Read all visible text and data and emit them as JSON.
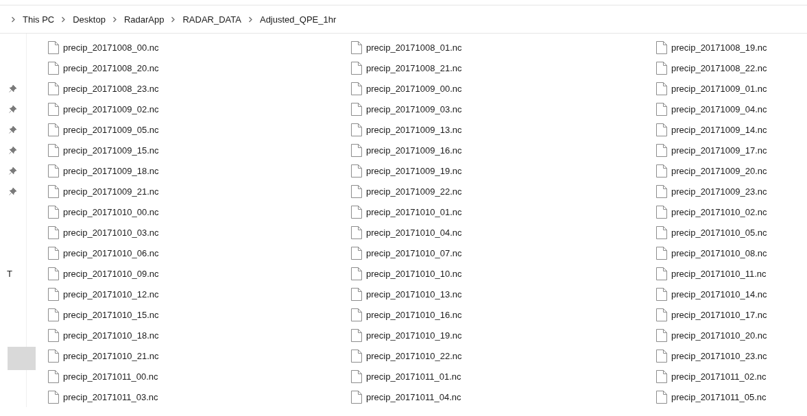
{
  "breadcrumb": [
    "This PC",
    "Desktop",
    "RadarApp",
    "RADAR_DATA",
    "Adjusted_QPE_1hr"
  ],
  "sidebar": {
    "items": [
      {
        "pinned": false,
        "selected": false
      },
      {
        "pinned": false,
        "selected": false
      },
      {
        "pinned": true,
        "selected": false
      },
      {
        "pinned": true,
        "selected": false
      },
      {
        "pinned": true,
        "selected": false
      },
      {
        "pinned": true,
        "selected": false
      },
      {
        "pinned": true,
        "selected": false
      },
      {
        "pinned": true,
        "selected": false
      },
      {
        "pinned": false,
        "selected": false
      },
      {
        "pinned": false,
        "selected": false
      },
      {
        "pinned": false,
        "selected": false
      },
      {
        "label": "T",
        "pinned": false,
        "selected": false
      },
      {
        "pinned": false,
        "selected": false
      },
      {
        "pinned": false,
        "selected": false
      },
      {
        "pinned": false,
        "selected": false
      },
      {
        "pinned": false,
        "selected": true
      }
    ]
  },
  "files": [
    "precip_20171008_00.nc",
    "precip_20171008_01.nc",
    "precip_20171008_19.nc",
    "precip_20171008_20.nc",
    "precip_20171008_21.nc",
    "precip_20171008_22.nc",
    "precip_20171008_23.nc",
    "precip_20171009_00.nc",
    "precip_20171009_01.nc",
    "precip_20171009_02.nc",
    "precip_20171009_03.nc",
    "precip_20171009_04.nc",
    "precip_20171009_05.nc",
    "precip_20171009_13.nc",
    "precip_20171009_14.nc",
    "precip_20171009_15.nc",
    "precip_20171009_16.nc",
    "precip_20171009_17.nc",
    "precip_20171009_18.nc",
    "precip_20171009_19.nc",
    "precip_20171009_20.nc",
    "precip_20171009_21.nc",
    "precip_20171009_22.nc",
    "precip_20171009_23.nc",
    "precip_20171010_00.nc",
    "precip_20171010_01.nc",
    "precip_20171010_02.nc",
    "precip_20171010_03.nc",
    "precip_20171010_04.nc",
    "precip_20171010_05.nc",
    "precip_20171010_06.nc",
    "precip_20171010_07.nc",
    "precip_20171010_08.nc",
    "precip_20171010_09.nc",
    "precip_20171010_10.nc",
    "precip_20171010_11.nc",
    "precip_20171010_12.nc",
    "precip_20171010_13.nc",
    "precip_20171010_14.nc",
    "precip_20171010_15.nc",
    "precip_20171010_16.nc",
    "precip_20171010_17.nc",
    "precip_20171010_18.nc",
    "precip_20171010_19.nc",
    "precip_20171010_20.nc",
    "precip_20171010_21.nc",
    "precip_20171010_22.nc",
    "precip_20171010_23.nc",
    "precip_20171011_00.nc",
    "precip_20171011_01.nc",
    "precip_20171011_02.nc",
    "precip_20171011_03.nc",
    "precip_20171011_04.nc",
    "precip_20171011_05.nc"
  ]
}
